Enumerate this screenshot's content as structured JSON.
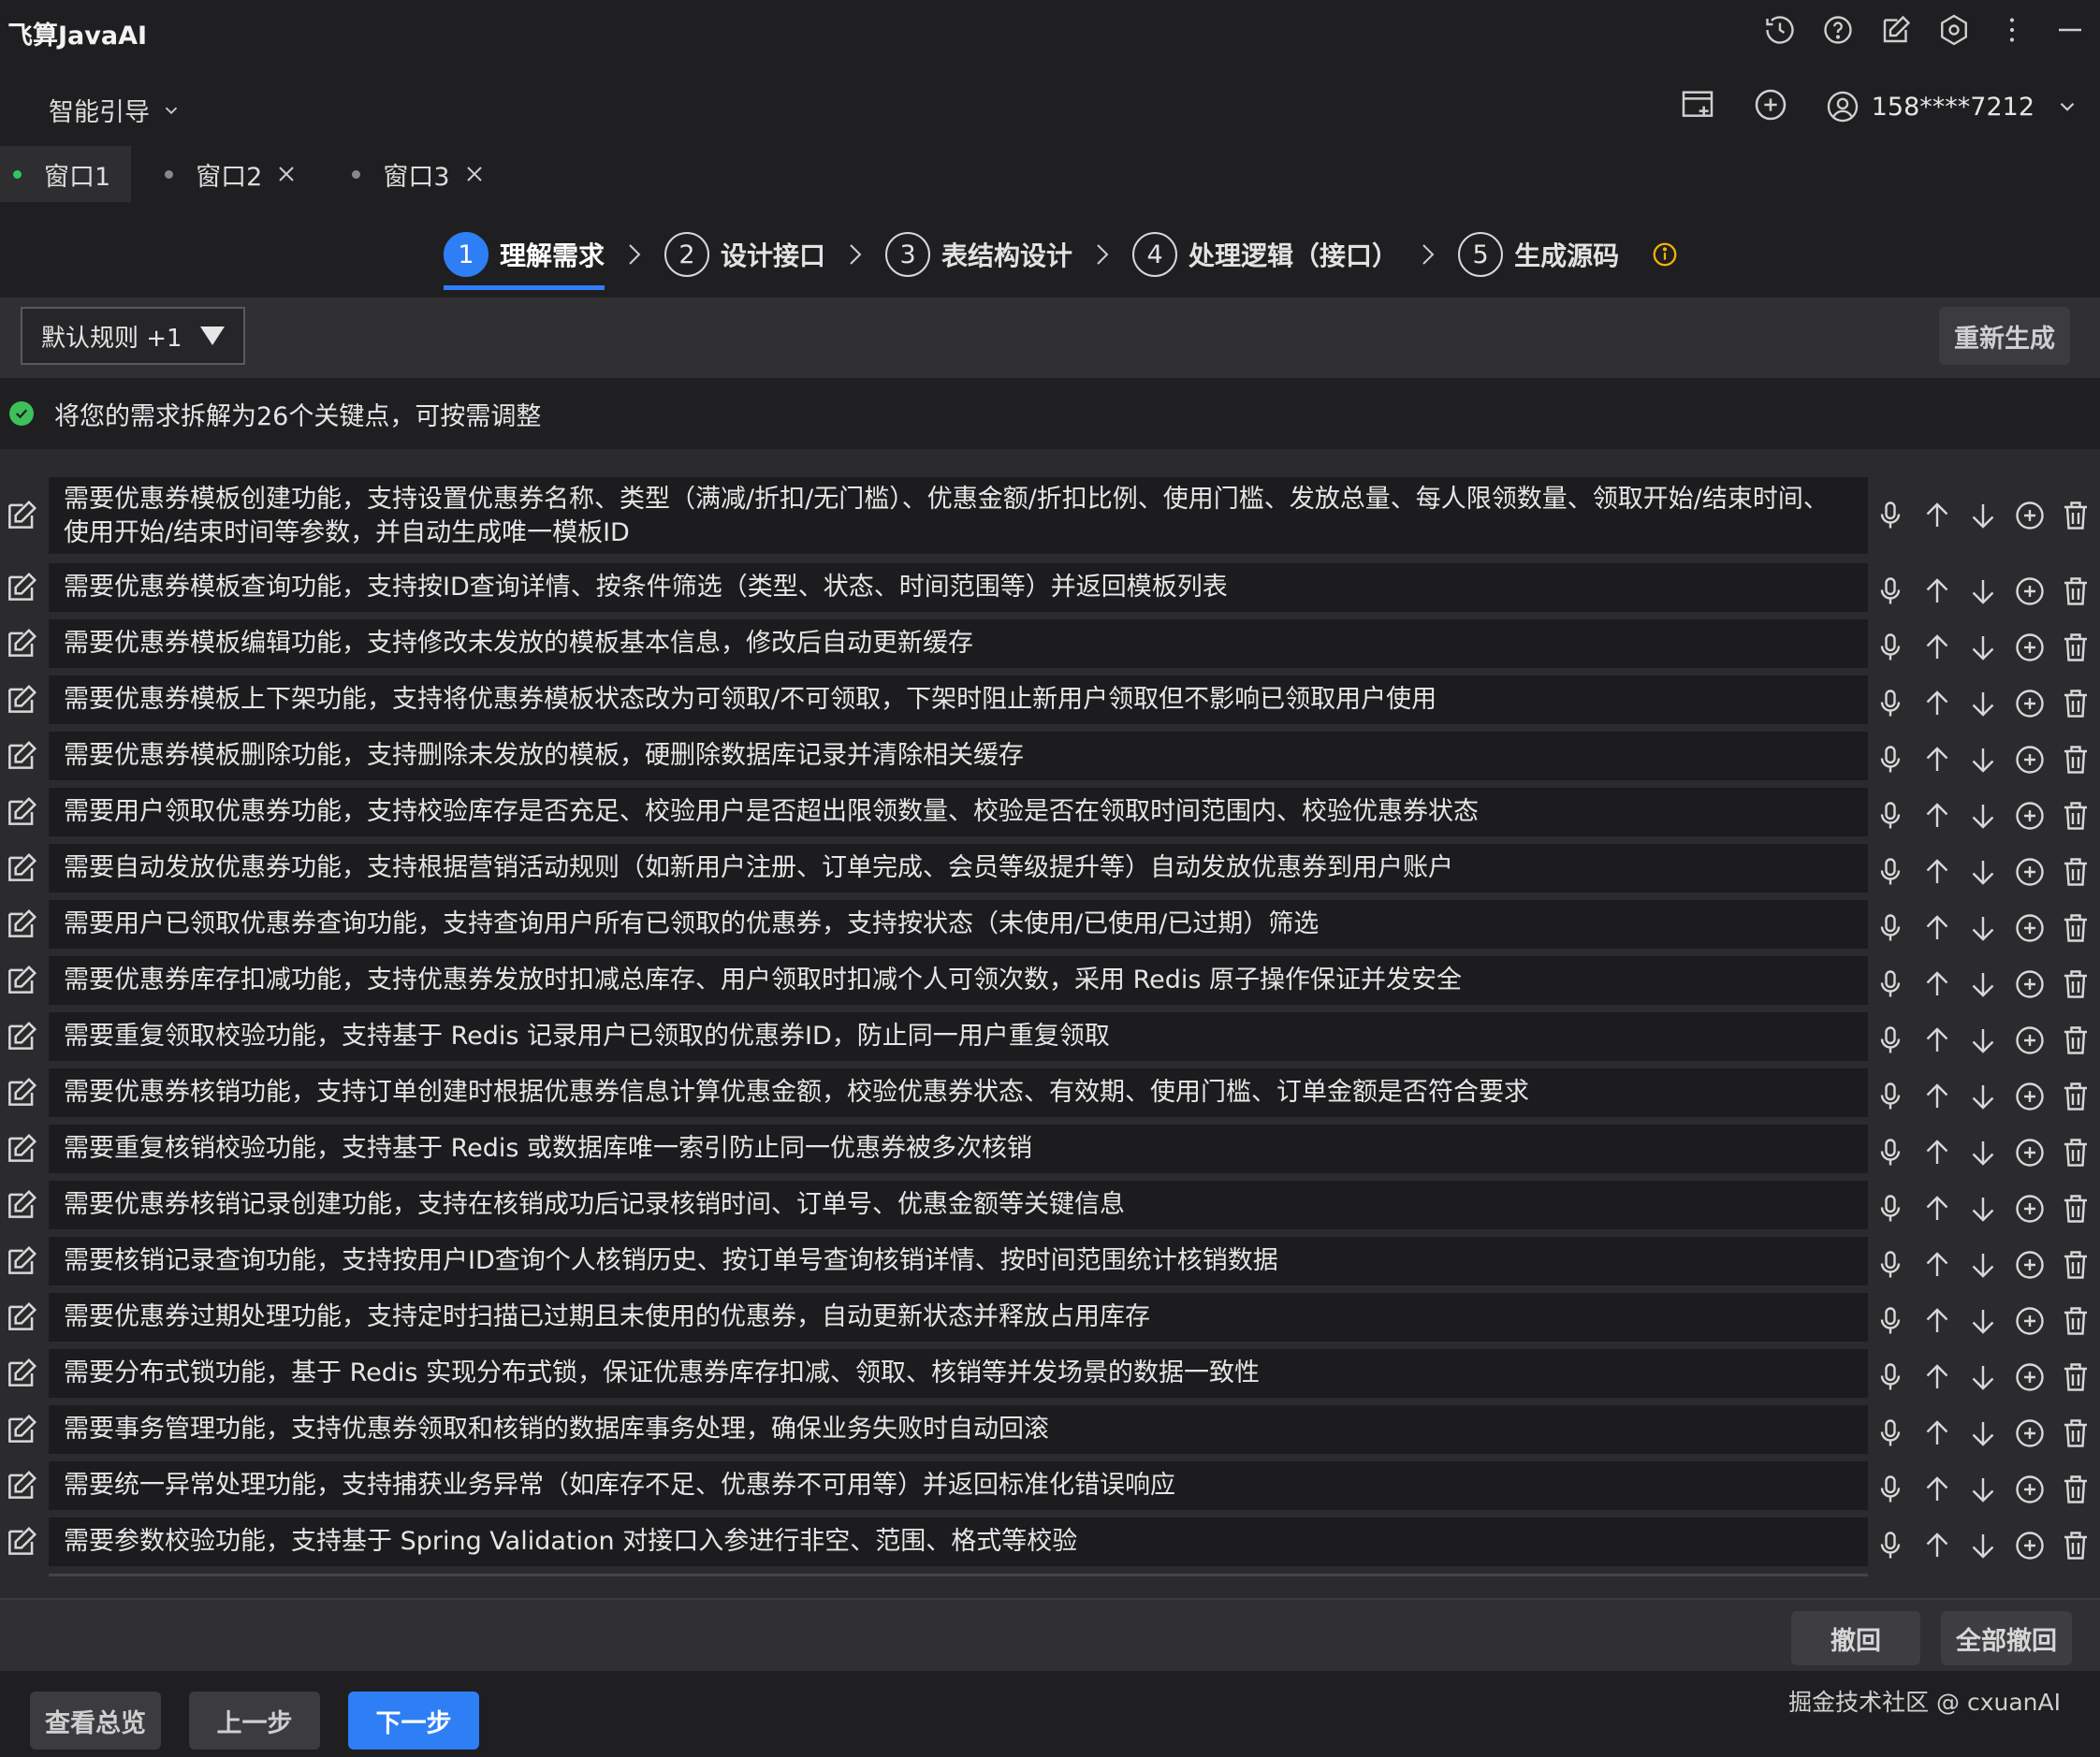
{
  "app": {
    "title": "飞算JavaAI"
  },
  "header": {
    "guide_label": "智能引导",
    "user_label": "158****7212"
  },
  "window_tabs": [
    {
      "label": "窗口1",
      "active": true
    },
    {
      "label": "窗口2",
      "active": false
    },
    {
      "label": "窗口3",
      "active": false
    }
  ],
  "steps": [
    {
      "num": "1",
      "label": "理解需求",
      "active": true
    },
    {
      "num": "2",
      "label": "设计接口",
      "active": false
    },
    {
      "num": "3",
      "label": "表结构设计",
      "active": false
    },
    {
      "num": "4",
      "label": "处理逻辑（接口）",
      "active": false
    },
    {
      "num": "5",
      "label": "生成源码",
      "active": false
    }
  ],
  "rules": {
    "selected": "默认规则 +1",
    "regenerate_label": "重新生成"
  },
  "notice": {
    "text": "将您的需求拆解为26个关键点，可按需调整"
  },
  "requirements": [
    "需要优惠券模板创建功能，支持设置优惠券名称、类型（满减/折扣/无门槛）、优惠金额/折扣比例、使用门槛、发放总量、每人限领数量、领取开始/结束时间、使用开始/结束时间等参数，并自动生成唯一模板ID",
    "需要优惠券模板查询功能，支持按ID查询详情、按条件筛选（类型、状态、时间范围等）并返回模板列表",
    "需要优惠券模板编辑功能，支持修改未发放的模板基本信息，修改后自动更新缓存",
    "需要优惠券模板上下架功能，支持将优惠券模板状态改为可领取/不可领取，下架时阻止新用户领取但不影响已领取用户使用",
    "需要优惠券模板删除功能，支持删除未发放的模板，硬删除数据库记录并清除相关缓存",
    "需要用户领取优惠券功能，支持校验库存是否充足、校验用户是否超出限领数量、校验是否在领取时间范围内、校验优惠券状态",
    "需要自动发放优惠券功能，支持根据营销活动规则（如新用户注册、订单完成、会员等级提升等）自动发放优惠券到用户账户",
    "需要用户已领取优惠券查询功能，支持查询用户所有已领取的优惠券，支持按状态（未使用/已使用/已过期）筛选",
    "需要优惠券库存扣减功能，支持优惠券发放时扣减总库存、用户领取时扣减个人可领次数，采用 Redis 原子操作保证并发安全",
    "需要重复领取校验功能，支持基于 Redis 记录用户已领取的优惠券ID，防止同一用户重复领取",
    "需要优惠券核销功能，支持订单创建时根据优惠券信息计算优惠金额，校验优惠券状态、有效期、使用门槛、订单金额是否符合要求",
    "需要重复核销校验功能，支持基于 Redis 或数据库唯一索引防止同一优惠券被多次核销",
    "需要优惠券核销记录创建功能，支持在核销成功后记录核销时间、订单号、优惠金额等关键信息",
    "需要核销记录查询功能，支持按用户ID查询个人核销历史、按订单号查询核销详情、按时间范围统计核销数据",
    "需要优惠券过期处理功能，支持定时扫描已过期且未使用的优惠券，自动更新状态并释放占用库存",
    "需要分布式锁功能，基于 Redis 实现分布式锁，保证优惠券库存扣减、领取、核销等并发场景的数据一致性",
    "需要事务管理功能，支持优惠券领取和核销的数据库事务处理，确保业务失败时自动回滚",
    "需要统一异常处理功能，支持捕获业务异常（如库存不足、优惠券不可用等）并返回标准化错误响应",
    "需要参数校验功能，支持基于 Spring Validation 对接口入参进行非空、范围、格式等校验"
  ],
  "undo_bar": {
    "undo_label": "撤回",
    "undo_all_label": "全部撤回"
  },
  "footer": {
    "overview_label": "查看总览",
    "prev_label": "上一步",
    "next_label": "下一步",
    "credit": "掘金技术社区 @ cxuanAI"
  },
  "colors": {
    "accent": "#2e7ef5",
    "success": "#3fbf5a",
    "warning": "#f5b400"
  }
}
